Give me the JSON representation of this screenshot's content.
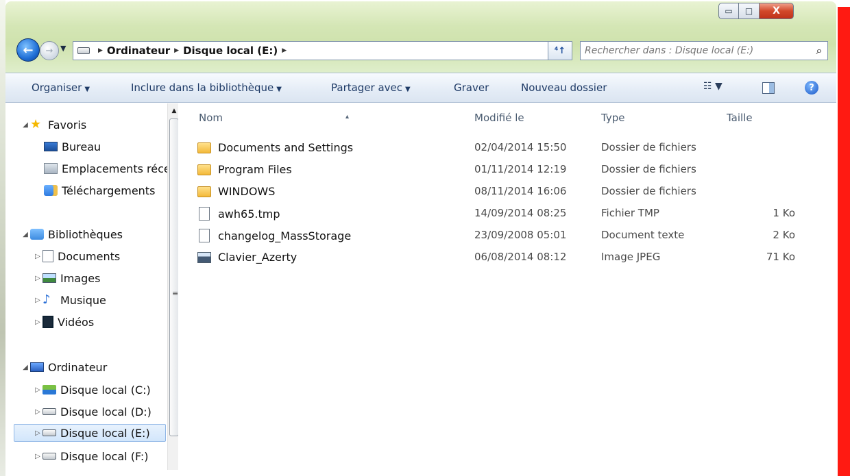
{
  "window": {
    "caption": {
      "minimize": "▭",
      "maximize": "□",
      "close": "X"
    }
  },
  "navigation": {
    "back_icon": "back-arrow-icon",
    "forward_icon": "forward-arrow-icon",
    "address": [
      "Ordinateur",
      "Disque local (E:)"
    ],
    "search_placeholder": "Rechercher dans : Disque local (E:)"
  },
  "commands": {
    "organize": "Organiser",
    "include": "Inclure dans la bibliothèque",
    "share": "Partager avec",
    "burn": "Graver",
    "new_folder": "Nouveau dossier"
  },
  "sidebar": {
    "favorites": {
      "label": "Favoris",
      "items": [
        "Bureau",
        "Emplacements récents",
        "Téléchargements"
      ]
    },
    "libraries": {
      "label": "Bibliothèques",
      "items": [
        "Documents",
        "Images",
        "Musique",
        "Vidéos"
      ]
    },
    "computer": {
      "label": "Ordinateur",
      "items": [
        "Disque local (C:)",
        "Disque local (D:)",
        "Disque local (E:)",
        "Disque local (F:)"
      ],
      "selected": "Disque local (E:)"
    }
  },
  "columns": {
    "name": "Nom",
    "modified": "Modifié le",
    "type": "Type",
    "size": "Taille"
  },
  "files": [
    {
      "name": "Documents and Settings",
      "modified": "02/04/2014 15:50",
      "type": "Dossier de fichiers",
      "size": "",
      "kind": "folder"
    },
    {
      "name": "Program Files",
      "modified": "01/11/2014 12:19",
      "type": "Dossier de fichiers",
      "size": "",
      "kind": "folder"
    },
    {
      "name": "WINDOWS",
      "modified": "08/11/2014 16:06",
      "type": "Dossier de fichiers",
      "size": "",
      "kind": "folder"
    },
    {
      "name": "awh65.tmp",
      "modified": "14/09/2014 08:25",
      "type": "Fichier TMP",
      "size": "1 Ko",
      "kind": "file"
    },
    {
      "name": "changelog_MassStorage",
      "modified": "23/09/2008 05:01",
      "type": "Document texte",
      "size": "2 Ko",
      "kind": "file"
    },
    {
      "name": "Clavier_Azerty",
      "modified": "06/08/2014 08:12",
      "type": "Image JPEG",
      "size": "71 Ko",
      "kind": "image"
    }
  ],
  "colors": {
    "accent": "#1e3a66",
    "aero": "#d4e6b5",
    "edge": "#ff1a12"
  }
}
